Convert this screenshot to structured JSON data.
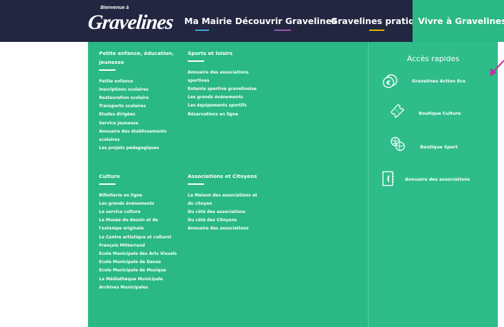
{
  "header": {
    "logo_small": "Bienvenue à",
    "logo_text": "Gravelines",
    "nav": [
      {
        "label": "Ma Mairie",
        "underline": "#3ea7e0"
      },
      {
        "label": "Découvrir Gravelines",
        "underline": "#9b59b6"
      },
      {
        "label": "Gravelines pratique",
        "underline": "#e7b400"
      },
      {
        "label": "Vivre à Gravelines",
        "underline": "#2ab885"
      }
    ]
  },
  "menu": {
    "col1a": {
      "heading": "Petite enfance, éducation, jeunesse",
      "items": [
        "Petite enfance",
        "Inscriptions scolaires",
        "Restauration scolaire",
        "Transports scolaires",
        "Etudes dirigées",
        "Service Jeunesse",
        "Annuaire des établissements scolaires",
        "Les projets pédagogiques"
      ]
    },
    "col1b": {
      "heading": "Culture",
      "items": [
        "Billetterie en ligne",
        "Les grands événements",
        "Le service culture",
        "Le Musée du dessin et de l'estampe originale",
        "Le Centre artistique et culturel François Mitterrand",
        "Ecole Municipale des Arts Visuels",
        "Ecole Municipale de Danse",
        "Ecole Municipale de Musique",
        "La Médiathèque Municipale",
        "Archives Municipales"
      ]
    },
    "col2a": {
      "heading": "Sports et loisirs",
      "items": [
        "Annuaire des associations sportives",
        "Entente sportive gravelinoise",
        "Les grands événements",
        "Les équipements sportifs",
        "Réservations en ligne"
      ]
    },
    "col2b": {
      "heading": "Associations et Citoyens",
      "items": [
        "La Maison des associations et du citoyen",
        "Du côté des associations",
        "Du côté des Citoyens",
        "Annuaire des associations"
      ]
    }
  },
  "quick_access": {
    "title": "Accès rapides",
    "items": [
      {
        "label": "Gravelines Action Eco",
        "icon": "euro-coin-icon"
      },
      {
        "label": "Boutique Culture",
        "icon": "ticket-icon"
      },
      {
        "label": "Boutique Sport",
        "icon": "sport-balls-icon"
      },
      {
        "label": "Annuaire des associations",
        "icon": "phone-book-icon"
      }
    ]
  },
  "colors": {
    "header_bg": "#232640",
    "menu_green": "#2ab885",
    "arrow": "#c0349a"
  }
}
